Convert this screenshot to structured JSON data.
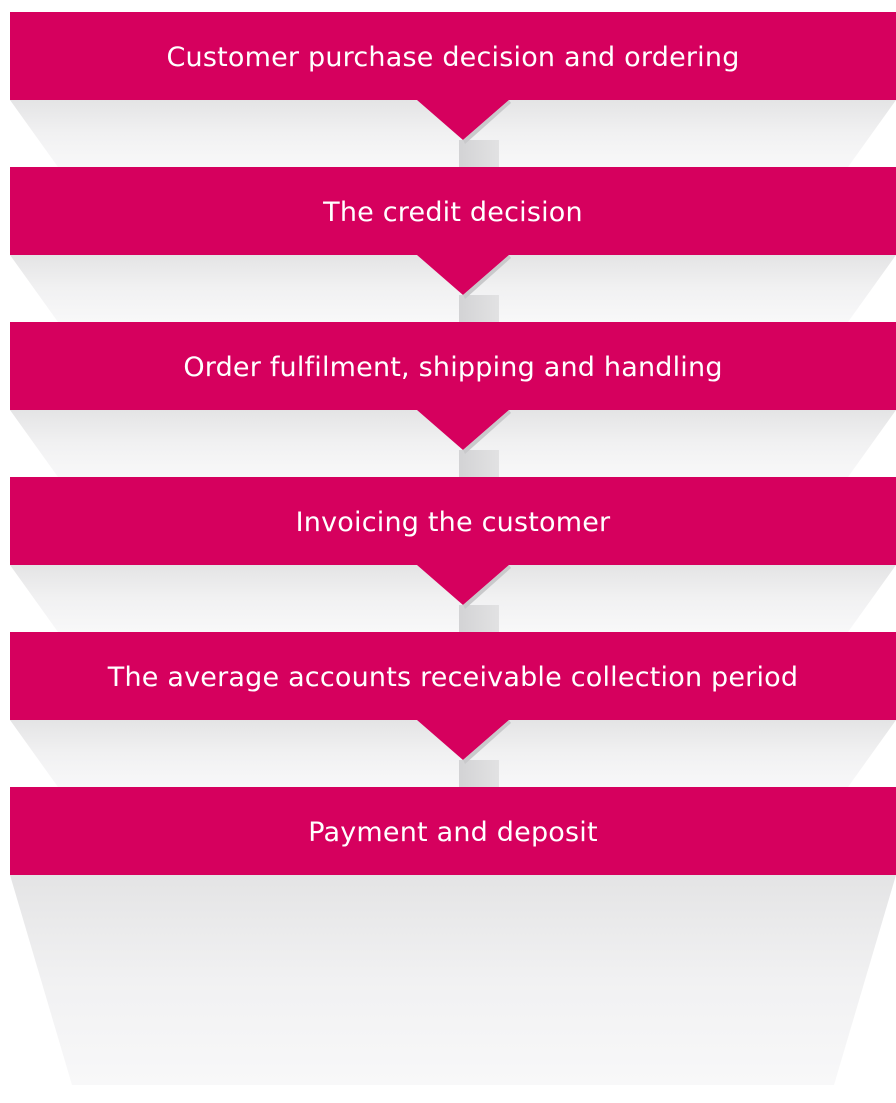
{
  "diagram": {
    "type": "process-flow",
    "colors": {
      "step_fill": "#d6005e",
      "connector_fill": "#eeeeef",
      "connector_shade": "#dcdcdd",
      "connector_edge": "#c9c9cb"
    },
    "steps": [
      {
        "label": "Customer purchase decision and ordering"
      },
      {
        "label": "The credit decision"
      },
      {
        "label": "Order fulfilment, shipping and handling"
      },
      {
        "label": "Invoicing the customer"
      },
      {
        "label": "The average accounts receivable collection period"
      },
      {
        "label": "Payment and deposit"
      }
    ]
  }
}
